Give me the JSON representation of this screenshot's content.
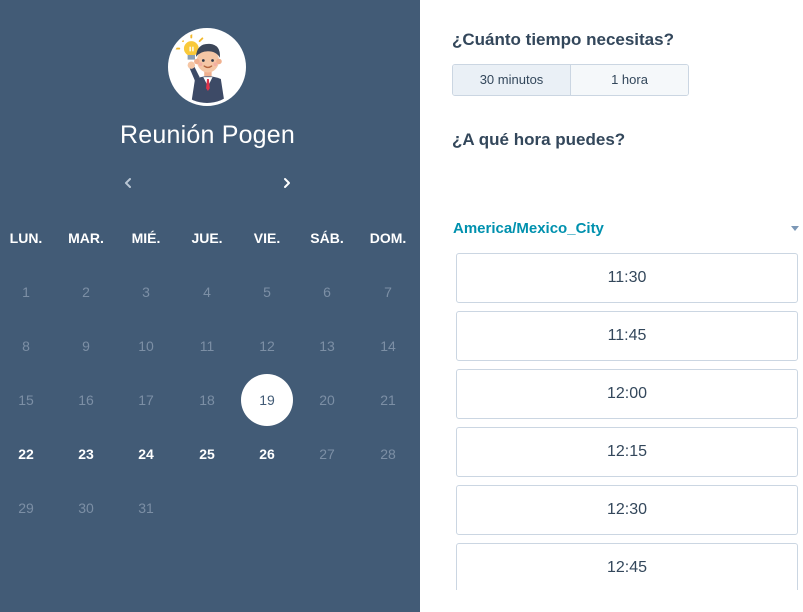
{
  "event": {
    "title": "Reunión Pogen"
  },
  "icons": {
    "avatar": "businessman-lightbulb-avatar",
    "prev": "chevron-left-icon",
    "next": "chevron-right-icon",
    "timezone_caret": "caret-down-icon"
  },
  "calendar": {
    "weekdays": [
      "LUN.",
      "MAR.",
      "MIÉ.",
      "JUE.",
      "VIE.",
      "SÁB.",
      "DOM."
    ],
    "weeks": [
      [
        {
          "d": "1",
          "s": "past"
        },
        {
          "d": "2",
          "s": "past"
        },
        {
          "d": "3",
          "s": "past"
        },
        {
          "d": "4",
          "s": "past"
        },
        {
          "d": "5",
          "s": "past"
        },
        {
          "d": "6",
          "s": "past"
        },
        {
          "d": "7",
          "s": "past"
        }
      ],
      [
        {
          "d": "8",
          "s": "past"
        },
        {
          "d": "9",
          "s": "past"
        },
        {
          "d": "10",
          "s": "past"
        },
        {
          "d": "11",
          "s": "past"
        },
        {
          "d": "12",
          "s": "past"
        },
        {
          "d": "13",
          "s": "past"
        },
        {
          "d": "14",
          "s": "past"
        }
      ],
      [
        {
          "d": "15",
          "s": "past"
        },
        {
          "d": "16",
          "s": "past"
        },
        {
          "d": "17",
          "s": "past"
        },
        {
          "d": "18",
          "s": "past"
        },
        {
          "d": "19",
          "s": "selected"
        },
        {
          "d": "20",
          "s": "past"
        },
        {
          "d": "21",
          "s": "past"
        }
      ],
      [
        {
          "d": "22",
          "s": "avail"
        },
        {
          "d": "23",
          "s": "avail"
        },
        {
          "d": "24",
          "s": "avail"
        },
        {
          "d": "25",
          "s": "avail"
        },
        {
          "d": "26",
          "s": "avail"
        },
        {
          "d": "27",
          "s": "past"
        },
        {
          "d": "28",
          "s": "past"
        }
      ],
      [
        {
          "d": "29",
          "s": "past"
        },
        {
          "d": "30",
          "s": "past"
        },
        {
          "d": "31",
          "s": "past"
        }
      ]
    ]
  },
  "duration": {
    "question": "¿Cuánto tiempo necesitas?",
    "options": [
      {
        "label": "30 minutos",
        "active": true
      },
      {
        "label": "1 hora",
        "active": false
      }
    ]
  },
  "time": {
    "question": "¿A qué hora puedes?",
    "timezone": "America/Mexico_City",
    "slots": [
      "11:30",
      "11:45",
      "12:00",
      "12:15",
      "12:30",
      "12:45"
    ]
  },
  "colors": {
    "panel": "#425b76",
    "link": "#0091ae",
    "text": "#33475b",
    "border": "#cbd6e2"
  }
}
